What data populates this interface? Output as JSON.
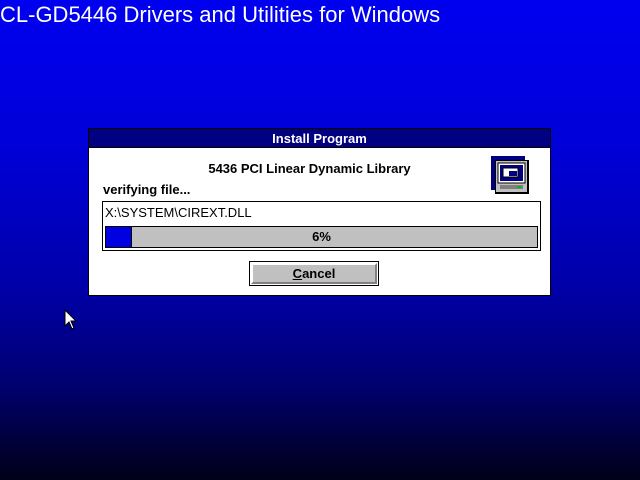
{
  "background": {
    "title": "CL-GD5446 Drivers and Utilities for Windows",
    "colors": {
      "gradient_top": "#0000f0",
      "gradient_bottom": "#000018"
    }
  },
  "dialog": {
    "title": "Install Program",
    "component": "5436 PCI Linear Dynamic Library",
    "status": "verifying file...",
    "file_path": "X:\\SYSTEM\\CIREXT.DLL",
    "progress": {
      "percent": 6,
      "label": "6%"
    },
    "cancel_button": {
      "mnemonic": "C",
      "rest": "ancel"
    },
    "icon": "setup-computer-icon",
    "colors": {
      "titlebar": "#000080",
      "progress_fill": "#0000e0",
      "progress_track": "#c0c0c0"
    }
  },
  "cursor": {
    "icon": "arrow-pointer-icon"
  }
}
